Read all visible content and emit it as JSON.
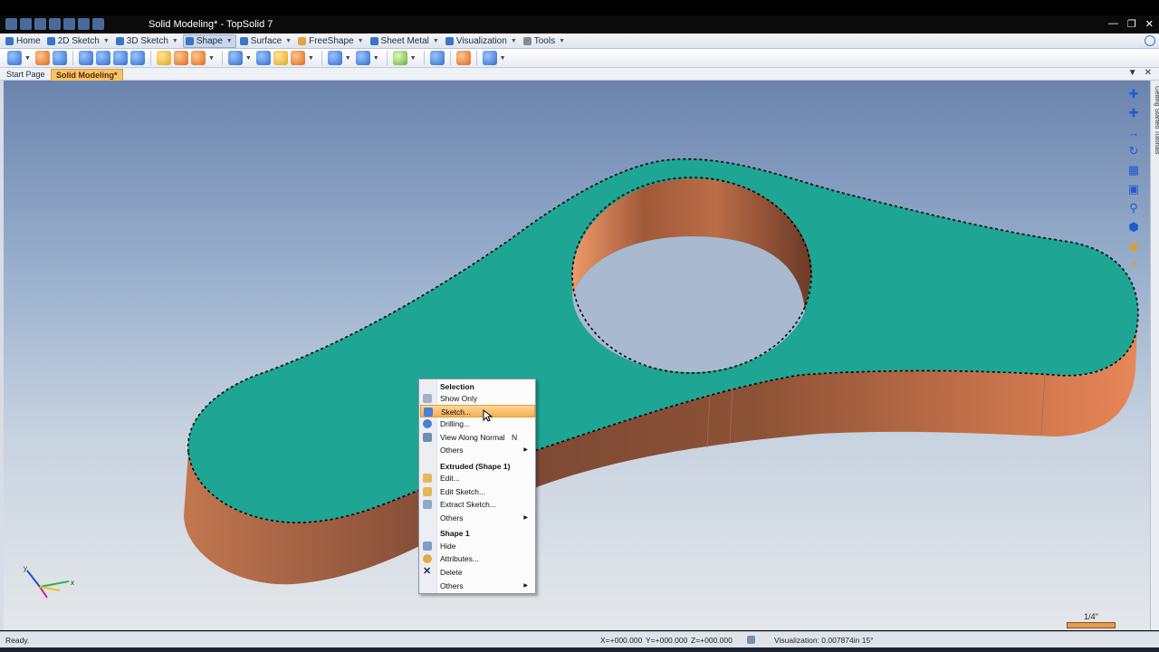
{
  "window": {
    "title": "Solid Modeling* - TopSolid 7",
    "controls": [
      "minimize-icon",
      "restore-icon",
      "close-icon"
    ]
  },
  "ribbon": {
    "tabs": [
      {
        "label": "Home",
        "icon": "home-icon"
      },
      {
        "label": "2D Sketch",
        "icon": "pencil-icon"
      },
      {
        "label": "3D Sketch",
        "icon": "pencil-3d-icon"
      },
      {
        "label": "Shape",
        "icon": "shape-icon",
        "active": true
      },
      {
        "label": "Surface",
        "icon": "surface-icon"
      },
      {
        "label": "FreeShape",
        "icon": "freeshape-icon"
      },
      {
        "label": "Sheet Metal",
        "icon": "sheet-metal-icon"
      },
      {
        "label": "Visualization",
        "icon": "visualization-icon"
      },
      {
        "label": "Tools",
        "icon": "tools-icon"
      }
    ]
  },
  "doc_tabs": {
    "items": [
      {
        "label": "Start Page"
      },
      {
        "label": "Solid Modeling*",
        "active": true
      }
    ]
  },
  "right_panel": {
    "label": "Getting Started Tutorials"
  },
  "context_menu": {
    "items": [
      {
        "type": "header",
        "label": "Selection"
      },
      {
        "type": "item",
        "label": "Show Only",
        "icon": "show-only-icon"
      },
      {
        "type": "item",
        "label": "Sketch...",
        "icon": "sketch-icon",
        "highlighted": true
      },
      {
        "type": "item",
        "label": "Drilling...",
        "icon": "drilling-icon"
      },
      {
        "type": "item",
        "label": "View Along Normal",
        "shortcut": "N",
        "icon": "view-normal-icon"
      },
      {
        "type": "submenu",
        "label": "Others"
      },
      {
        "type": "header",
        "label": "Extruded (Shape 1)"
      },
      {
        "type": "item",
        "label": "Edit...",
        "icon": "edit-icon"
      },
      {
        "type": "item",
        "label": "Edit Sketch...",
        "icon": "edit-sketch-icon"
      },
      {
        "type": "item",
        "label": "Extract Sketch...",
        "icon": "extract-sketch-icon"
      },
      {
        "type": "submenu",
        "label": "Others"
      },
      {
        "type": "header",
        "label": "Shape 1"
      },
      {
        "type": "item",
        "label": "Hide",
        "icon": "hide-icon"
      },
      {
        "type": "item",
        "label": "Attributes...",
        "icon": "attributes-icon"
      },
      {
        "type": "item",
        "label": "Delete",
        "icon": "delete-icon"
      },
      {
        "type": "submenu",
        "label": "Others"
      }
    ]
  },
  "scale": {
    "label": "1/4\""
  },
  "status": {
    "left": "Ready.",
    "x": "X=+000.000",
    "y": "Y=+000.000",
    "z": "Z=+000.000",
    "visualization": "Visualization: 0.007874in 15°"
  },
  "triad": {
    "x_label": "x",
    "y_label": "y"
  },
  "colors": {
    "face": "#1fa593",
    "side": "#b96a45",
    "highlight": "#f4b04e",
    "accent": "#3c74c8"
  }
}
